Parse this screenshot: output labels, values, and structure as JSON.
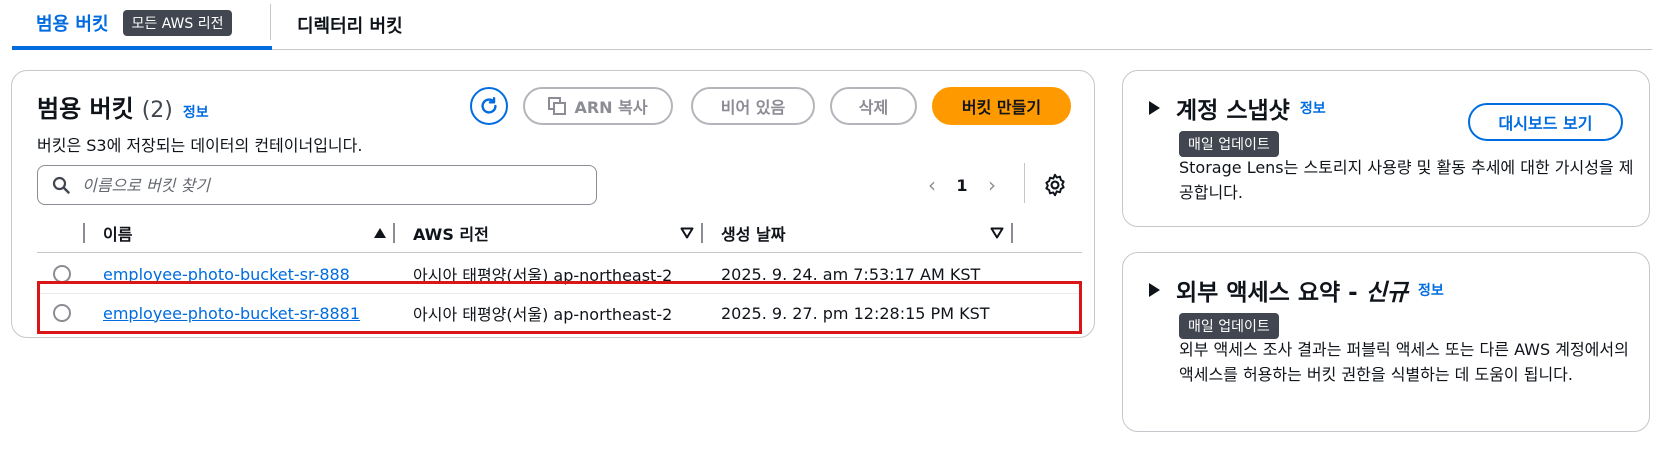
{
  "tabs": {
    "general": "범용 버킷",
    "region_badge": "모든 AWS 리전",
    "directory": "디렉터리 버킷"
  },
  "main": {
    "title": "범용 버킷",
    "count": "(2)",
    "info": "정보",
    "description": "버킷은 S3에 저장되는 데이터의 컨테이너입니다.",
    "buttons": {
      "copy_arn": "ARN 복사",
      "empty": "비어 있음",
      "delete": "삭제",
      "create": "버킷 만들기"
    },
    "search": {
      "placeholder": "이름으로 버킷 찾기",
      "value": ""
    },
    "pager": {
      "page": "1"
    },
    "columns": [
      "이름",
      "AWS 리전",
      "생성 날짜"
    ],
    "rows": [
      {
        "name": "employee-photo-bucket-sr-888",
        "region": "아시아 태평양(서울) ap-northeast-2",
        "created": "2025. 9. 24. am 7:53:17 AM KST"
      },
      {
        "name": "employee-photo-bucket-sr-8881",
        "region": "아시아 태평양(서울) ap-northeast-2",
        "created": "2025. 9. 27. pm 12:28:15 PM KST"
      }
    ]
  },
  "snapshot": {
    "title": "계정 스냅샷",
    "info": "정보",
    "badge": "매일 업데이트",
    "description": "Storage Lens는 스토리지 사용량 및 활동 추세에 대한 가시성을 제공합니다.",
    "button": "대시보드 보기"
  },
  "external": {
    "title": "외부 액세스 요약 - ",
    "title_new": "신규",
    "info": "정보",
    "badge": "매일 업데이트",
    "description": "외부 액세스 조사 결과는 퍼블릭 액세스 또는 다른 AWS 계정에서의 액세스를 허용하는 버킷 권한을 식별하는 데 도움이 됩니다."
  },
  "colors": {
    "accent": "#006ce0",
    "primary_button": "#ff9900",
    "highlight": "#d91515",
    "badge": "#424650"
  }
}
